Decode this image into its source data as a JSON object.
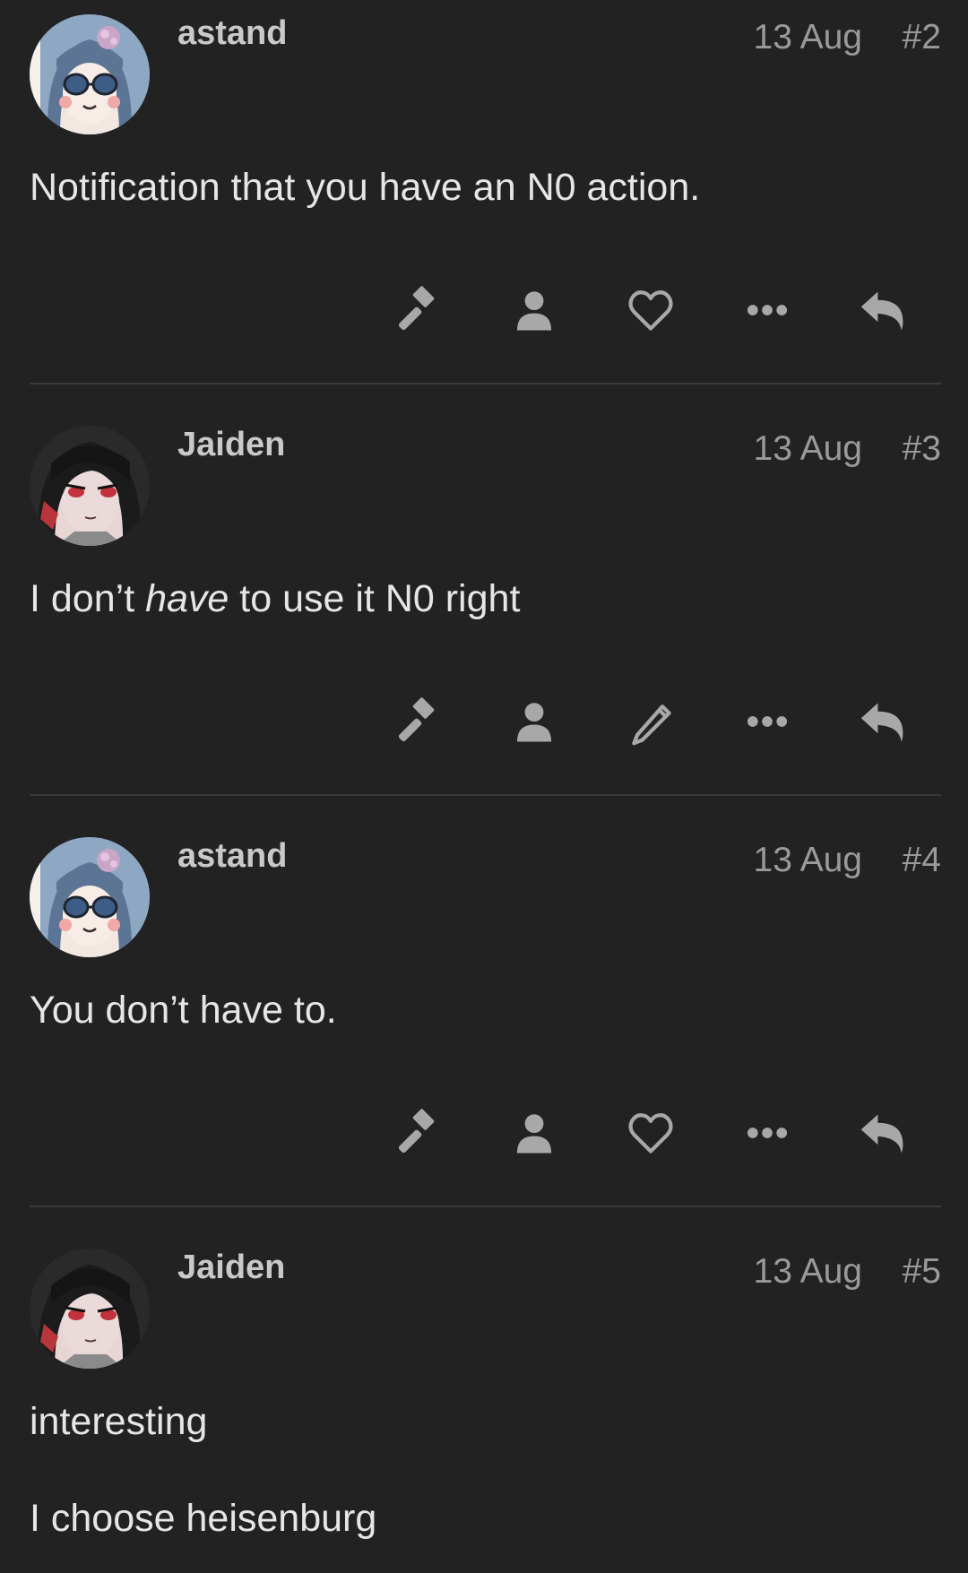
{
  "posts": [
    {
      "username": "astand",
      "date": "13 Aug",
      "number": "#2",
      "text": "Notification that you have an N0 action.",
      "avatar": "avatar-blue-hair-sunglasses",
      "third_action": "heart-icon"
    },
    {
      "username": "Jaiden",
      "date": "13 Aug",
      "number": "#3",
      "text_before": "I don’t ",
      "text_em": "have",
      "text_after": " to use it N0 right",
      "avatar": "avatar-dark-hair-red-eyes",
      "third_action": "pencil-icon"
    },
    {
      "username": "astand",
      "date": "13 Aug",
      "number": "#4",
      "text": "You don’t have to.",
      "avatar": "avatar-blue-hair-sunglasses",
      "third_action": "heart-icon"
    },
    {
      "username": "Jaiden",
      "date": "13 Aug",
      "number": "#5",
      "text": "interesting",
      "text_line2": "I choose heisenburg",
      "avatar": "avatar-dark-hair-red-eyes"
    }
  ],
  "icon_color": "#a8a8a8",
  "background": "#222222",
  "divider_color": "#3a3a3a"
}
